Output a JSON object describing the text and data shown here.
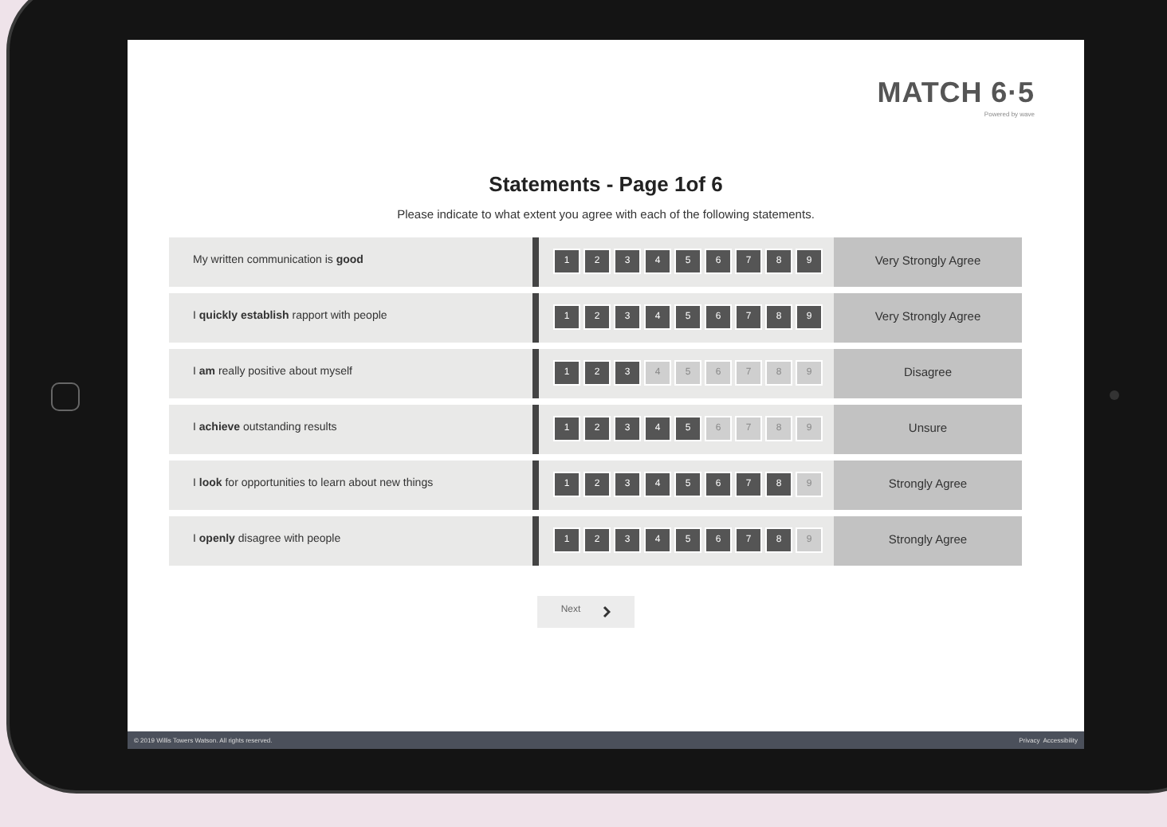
{
  "logo": {
    "title": "MATCH 6·5",
    "tagline": "Powered by wave"
  },
  "heading": "Statements - Page 1of 6",
  "instructions": "Please indicate to what extent you agree with each of the following statements.",
  "statements": [
    {
      "text": "My written communication is **good**",
      "answer": "Very Strongly Agree",
      "options": [
        {
          "label": "1",
          "filled": true
        },
        {
          "label": "2",
          "filled": true
        },
        {
          "label": "3",
          "filled": true
        },
        {
          "label": "4",
          "filled": true
        },
        {
          "label": "5",
          "filled": true
        },
        {
          "label": "6",
          "filled": true
        },
        {
          "label": "7",
          "filled": true
        },
        {
          "label": "8",
          "filled": true
        },
        {
          "label": "9",
          "filled": true
        }
      ]
    },
    {
      "text": "I **quickly establish** rapport with people",
      "answer": "Very Strongly Agree",
      "options": [
        {
          "label": "1",
          "filled": true
        },
        {
          "label": "2",
          "filled": true
        },
        {
          "label": "3",
          "filled": true
        },
        {
          "label": "4",
          "filled": true
        },
        {
          "label": "5",
          "filled": true
        },
        {
          "label": "6",
          "filled": true
        },
        {
          "label": "7",
          "filled": true
        },
        {
          "label": "8",
          "filled": true
        },
        {
          "label": "9",
          "filled": true
        }
      ]
    },
    {
      "text": "I **am** really positive about myself",
      "answer": "Disagree",
      "options": [
        {
          "label": "1",
          "filled": true
        },
        {
          "label": "2",
          "filled": true
        },
        {
          "label": "3",
          "filled": true
        },
        {
          "label": "4",
          "filled": false
        },
        {
          "label": "5",
          "filled": false
        },
        {
          "label": "6",
          "filled": false
        },
        {
          "label": "7",
          "filled": false
        },
        {
          "label": "8",
          "filled": false
        },
        {
          "label": "9",
          "filled": false
        }
      ]
    },
    {
      "text": "I **achieve** outstanding results",
      "answer": "Unsure",
      "options": [
        {
          "label": "1",
          "filled": true
        },
        {
          "label": "2",
          "filled": true
        },
        {
          "label": "3",
          "filled": true
        },
        {
          "label": "4",
          "filled": true
        },
        {
          "label": "5",
          "filled": true
        },
        {
          "label": "6",
          "filled": false
        },
        {
          "label": "7",
          "filled": false
        },
        {
          "label": "8",
          "filled": false
        },
        {
          "label": "9",
          "filled": false
        }
      ]
    },
    {
      "text": "I **look** for opportunities to learn about new things",
      "answer": "Strongly Agree",
      "options": [
        {
          "label": "1",
          "filled": true
        },
        {
          "label": "2",
          "filled": true
        },
        {
          "label": "3",
          "filled": true
        },
        {
          "label": "4",
          "filled": true
        },
        {
          "label": "5",
          "filled": true
        },
        {
          "label": "6",
          "filled": true
        },
        {
          "label": "7",
          "filled": true
        },
        {
          "label": "8",
          "filled": true
        },
        {
          "label": "9",
          "filled": false
        }
      ]
    },
    {
      "text": "I **openly** disagree with people",
      "answer": "Strongly Agree",
      "options": [
        {
          "label": "1",
          "filled": true
        },
        {
          "label": "2",
          "filled": true
        },
        {
          "label": "3",
          "filled": true
        },
        {
          "label": "4",
          "filled": true
        },
        {
          "label": "5",
          "filled": true
        },
        {
          "label": "6",
          "filled": true
        },
        {
          "label": "7",
          "filled": true
        },
        {
          "label": "8",
          "filled": true
        },
        {
          "label": "9",
          "filled": false
        }
      ]
    }
  ],
  "next_button": "Next",
  "footer": {
    "copyright": "© 2019 Willis Towers Watson. All rights reserved.",
    "links": [
      "Privacy",
      "Accessibility"
    ]
  }
}
